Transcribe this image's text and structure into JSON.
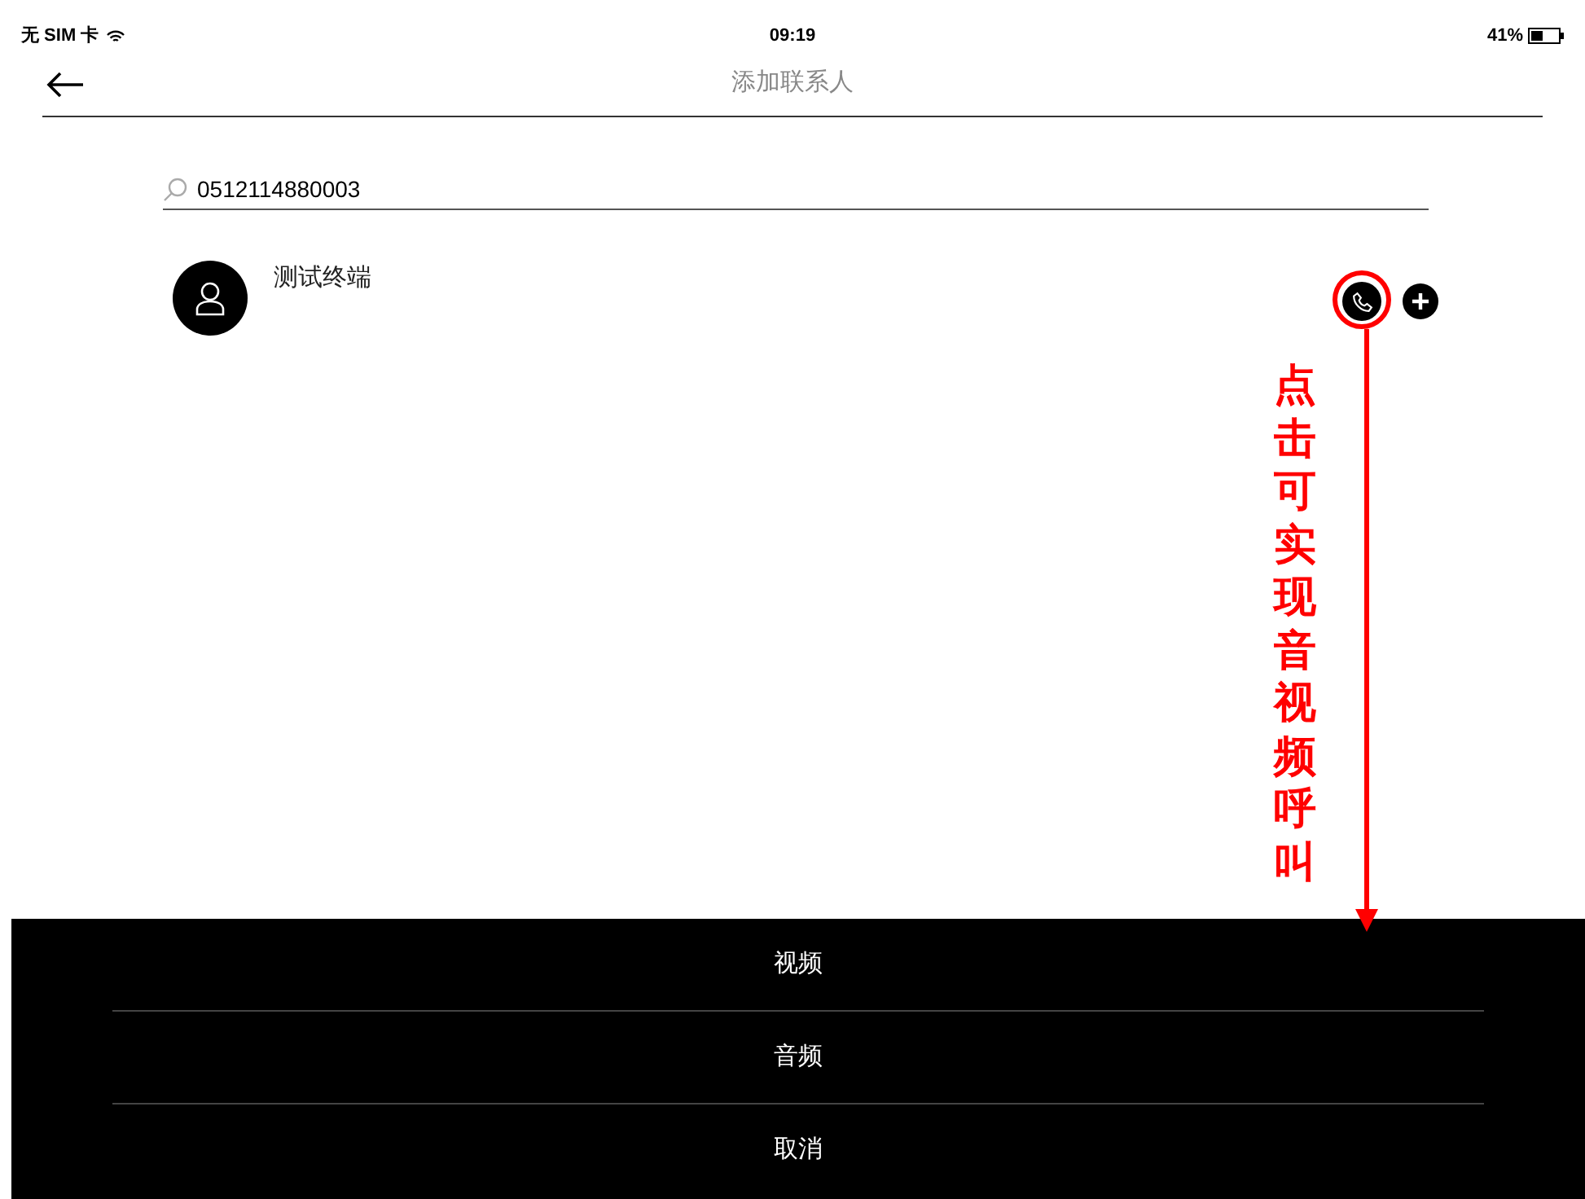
{
  "status_bar": {
    "carrier": "无 SIM 卡",
    "time": "09:19",
    "battery": "41%"
  },
  "nav": {
    "title": "添加联系人"
  },
  "search": {
    "value": "0512114880003"
  },
  "contacts": [
    {
      "name": "测试终端"
    }
  ],
  "annotation": {
    "text": "点击可实现音视频呼叫"
  },
  "action_sheet": {
    "items": [
      "视频",
      "音频",
      "取消"
    ]
  }
}
